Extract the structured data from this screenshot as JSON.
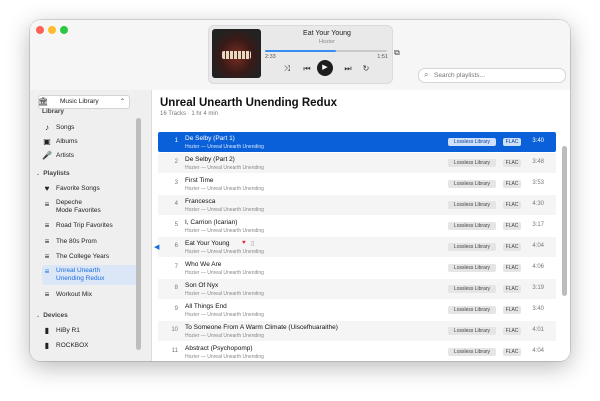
{
  "player": {
    "title": "Eat Your Young",
    "artist": "Hozier",
    "elapsed": "2:33",
    "remaining": "1:51",
    "progress": 0.58,
    "icons": {
      "shuffle": "shuffle-icon",
      "previous": "previous-icon",
      "play": "play-icon",
      "next": "next-icon",
      "repeat": "repeat-icon",
      "airplay": "airplay-icon"
    }
  },
  "search": {
    "placeholder": "Search playlists..."
  },
  "sidebar": {
    "library_label": "Music Library",
    "library_header": "Library",
    "library_items": [
      {
        "label": "Songs",
        "icon": "music-note-icon"
      },
      {
        "label": "Albums",
        "icon": "album-icon"
      },
      {
        "label": "Artists",
        "icon": "microphone-icon"
      }
    ],
    "playlists_header": "Playlists",
    "playlists": [
      {
        "label": "Favorite Songs",
        "icon": "heart-icon"
      },
      {
        "label": "Depeche\nMode Favorites",
        "icon": "playlist-icon"
      },
      {
        "label": "Road Trip Favorites",
        "icon": "playlist-icon"
      },
      {
        "label": "The 80s Prom",
        "icon": "playlist-icon"
      },
      {
        "label": "The College Years",
        "icon": "playlist-icon"
      },
      {
        "label": "Unreal Unearth\nUnending Redux",
        "icon": "playlist-icon"
      },
      {
        "label": "Workout Mix",
        "icon": "playlist-icon"
      }
    ],
    "devices_header": "Devices",
    "devices": [
      {
        "label": "HiBy R1",
        "icon": "device-icon"
      },
      {
        "label": "ROCKBOX",
        "icon": "device-icon"
      }
    ]
  },
  "playlist": {
    "title": "Unreal Unearth Unending Redux",
    "meta": "16 Tracks · 1 hr 4 min",
    "tracks": [
      {
        "num": "1",
        "title": "De Selby (Part 1)",
        "sub": "Hozier — Unreal Unearth Unending",
        "badge1": "Lossless Library",
        "badge2": "FLAC",
        "dur": "3:40"
      },
      {
        "num": "2",
        "title": "De Selby (Part 2)",
        "sub": "Hozier — Unreal Unearth Unending",
        "badge1": "Lossless Library",
        "badge2": "FLAC",
        "dur": "3:48"
      },
      {
        "num": "3",
        "title": "First Time",
        "sub": "Hozier — Unreal Unearth Unending",
        "badge1": "Lossless Library",
        "badge2": "FLAC",
        "dur": "3:53"
      },
      {
        "num": "4",
        "title": "Francesca",
        "sub": "Hozier — Unreal Unearth Unending",
        "badge1": "Lossless Library",
        "badge2": "FLAC",
        "dur": "4:30"
      },
      {
        "num": "5",
        "title": "I, Carrion (Icarian)",
        "sub": "Hozier — Unreal Unearth Unending",
        "badge1": "Lossless Library",
        "badge2": "FLAC",
        "dur": "3:17"
      },
      {
        "num": "6",
        "title": "Eat Your Young",
        "sub": "Hozier — Unreal Unearth Unending",
        "badge1": "Lossless Library",
        "badge2": "FLAC",
        "dur": "4:04"
      },
      {
        "num": "7",
        "title": "Who We Are",
        "sub": "Hozier — Unreal Unearth Unending",
        "badge1": "Lossless Library",
        "badge2": "FLAC",
        "dur": "4:06"
      },
      {
        "num": "8",
        "title": "Son Of Nyx",
        "sub": "Hozier — Unreal Unearth Unending",
        "badge1": "Lossless Library",
        "badge2": "FLAC",
        "dur": "3:19"
      },
      {
        "num": "9",
        "title": "All Things End",
        "sub": "Hozier — Unreal Unearth Unending",
        "badge1": "Lossless Library",
        "badge2": "FLAC",
        "dur": "3:40"
      },
      {
        "num": "10",
        "title": "To Someone From A Warm Climate (Uiscefhuaraithe)",
        "sub": "Hozier — Unreal Unearth Unending",
        "badge1": "Lossless Library",
        "badge2": "FLAC",
        "dur": "4:01"
      },
      {
        "num": "11",
        "title": "Abstract (Psychopomp)",
        "sub": "Hozier — Unreal Unearth Unending",
        "badge1": "Lossless Library",
        "badge2": "FLAC",
        "dur": "4:04"
      }
    ]
  }
}
